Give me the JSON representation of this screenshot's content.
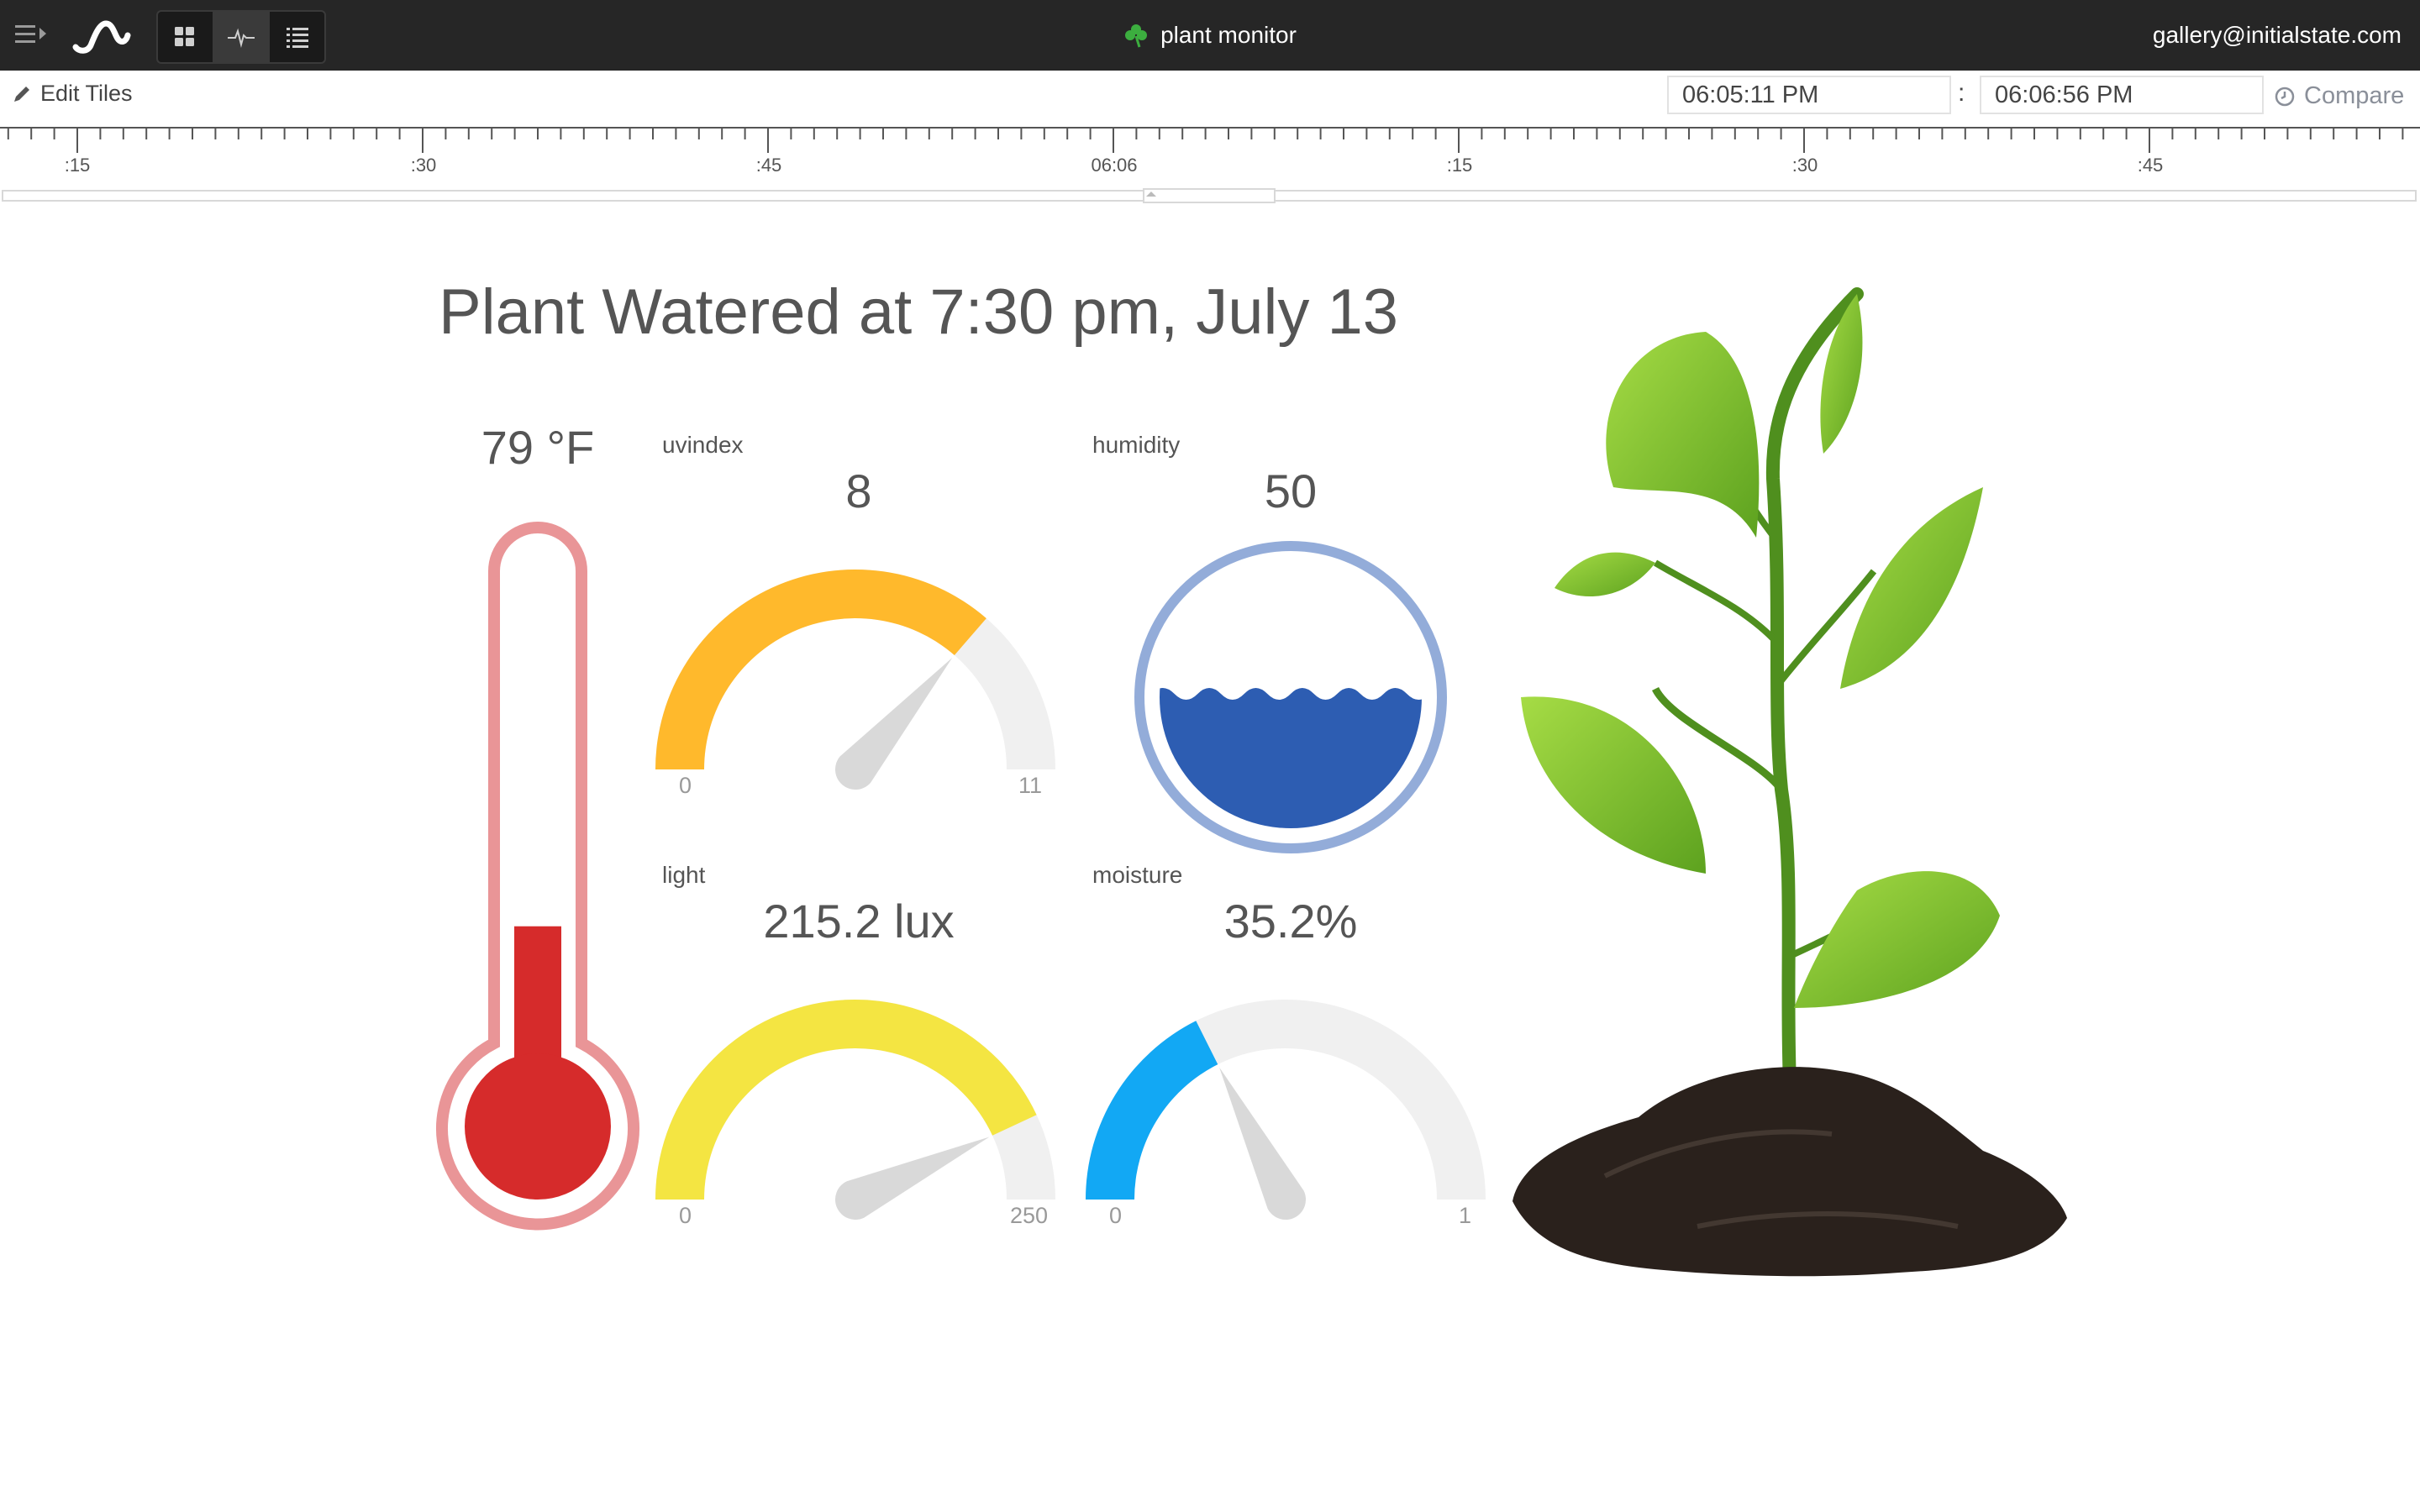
{
  "header": {
    "app_title": "plant monitor",
    "user_email": "gallery@initialstate.com",
    "views": [
      "tiles-view",
      "waves-view",
      "lines-view"
    ]
  },
  "toolbar": {
    "edit_tiles_label": "Edit Tiles",
    "start_time": "06:05:11 PM",
    "separator": ":",
    "end_time": "06:06:56 PM",
    "compare_label": "Compare"
  },
  "timeline": {
    "tick_labels": [
      ":15",
      ":30",
      ":45",
      "06:06",
      ":15",
      ":30",
      ":45"
    ]
  },
  "dashboard": {
    "title": "Plant Watered at 7:30 pm, July 13",
    "temperature": {
      "value_text": "79 °F",
      "fill_fraction": 0.33,
      "color": "#d62b2b",
      "outline_color": "#e99597"
    },
    "uvindex": {
      "label": "uvindex",
      "value_text": "8",
      "value": 8,
      "min": 0,
      "max": 11,
      "min_label": "0",
      "max_label": "11",
      "color": "#ffb92c"
    },
    "humidity": {
      "label": "humidity",
      "value_text": "50",
      "value": 50,
      "color": "#2d5db2",
      "ring_color": "#93acd9"
    },
    "light": {
      "label": "light",
      "value_text": "215.2 lux",
      "value": 215.2,
      "min": 0,
      "max": 250,
      "min_label": "0",
      "max_label": "250",
      "color": "#f4e542"
    },
    "moisture": {
      "label": "moisture",
      "value_text": "35.2%",
      "value": 0.352,
      "min": 0,
      "max": 1,
      "min_label": "0",
      "max_label": "1",
      "color": "#12a8f4"
    }
  },
  "colors": {
    "topbar_bg": "#262626",
    "gauge_track": "#f0f0f0",
    "needle": "#d9d9d9",
    "leaf": "#7cc22f",
    "soil": "#2a211c"
  }
}
